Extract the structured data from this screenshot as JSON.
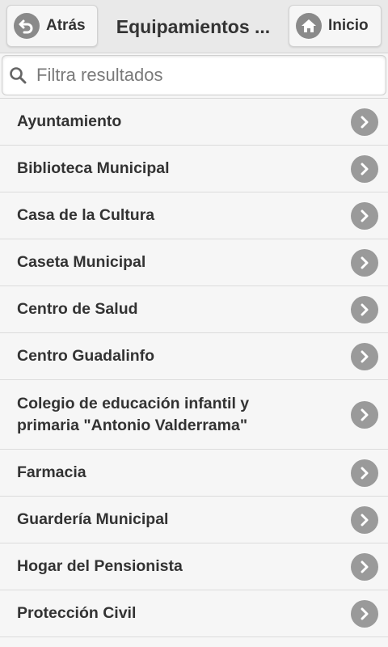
{
  "header": {
    "back_label": "Atrás",
    "title": "Equipamientos ...",
    "home_label": "Inicio"
  },
  "search": {
    "placeholder": "Filtra resultados",
    "value": ""
  },
  "items": [
    {
      "label": "Ayuntamiento"
    },
    {
      "label": "Biblioteca Municipal"
    },
    {
      "label": "Casa de la Cultura"
    },
    {
      "label": "Caseta Municipal"
    },
    {
      "label": "Centro de Salud"
    },
    {
      "label": "Centro Guadalinfo"
    },
    {
      "label": "Colegio de educación infantil y primaria \"Antonio Valderrama\""
    },
    {
      "label": "Farmacia"
    },
    {
      "label": "Guardería Municipal"
    },
    {
      "label": "Hogar del Pensionista"
    },
    {
      "label": "Protección Civil"
    }
  ],
  "icons": {
    "back": "undo-arrow-icon",
    "home": "home-icon",
    "search": "search-icon",
    "chevron": "chevron-right-icon"
  },
  "colors": {
    "header_bg": "#e9e9e9",
    "list_bg": "#f6f6f6",
    "icon_grey": "#9a9a9a",
    "text": "#333333"
  }
}
